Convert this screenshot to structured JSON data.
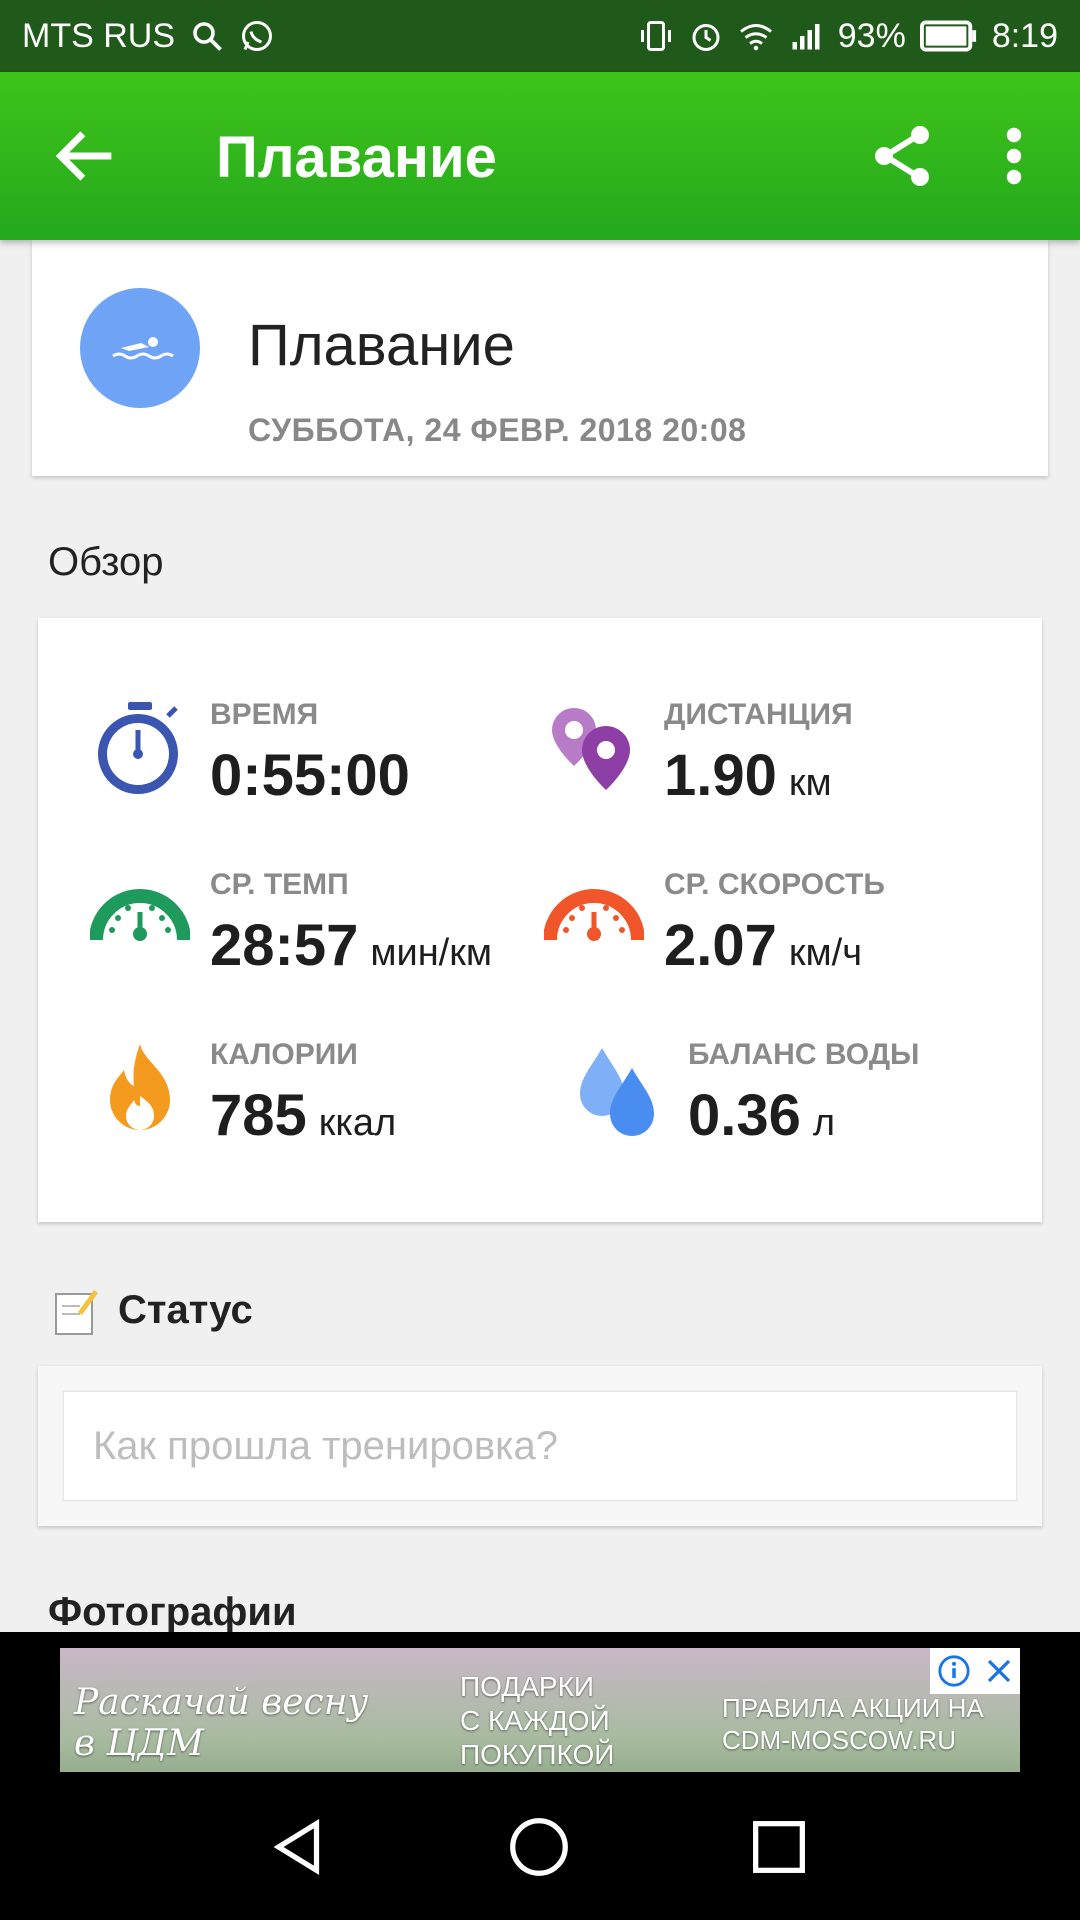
{
  "status_bar": {
    "carrier": "MTS RUS",
    "battery": "93%",
    "time": "8:19"
  },
  "app_bar": {
    "title": "Плавание"
  },
  "activity": {
    "name": "Плавание",
    "datetime": "СУББОТА, 24 ФЕВР. 2018 20:08",
    "avatar_icon": "swimmer-icon",
    "avatar_color": "#6fa3f5"
  },
  "overview": {
    "section_title": "Обзор",
    "metrics": [
      {
        "label": "ВРЕМЯ",
        "value": "0:55:00",
        "unit": "",
        "icon": "stopwatch-icon",
        "color": "#3a56b0"
      },
      {
        "label": "ДИСТАНЦИЯ",
        "value": "1.90",
        "unit": "км",
        "icon": "map-pins-icon",
        "color": "#8e3fa6"
      },
      {
        "label": "СР. ТЕМП",
        "value": "28:57",
        "unit": "мин/км",
        "icon": "gauge-green-icon",
        "color": "#1e9a5c"
      },
      {
        "label": "СР. СКОРОСТЬ",
        "value": "2.07",
        "unit": "км/ч",
        "icon": "gauge-orange-icon",
        "color": "#f0562a"
      },
      {
        "label": "КАЛОРИИ",
        "value": "785",
        "unit": "ккал",
        "icon": "flame-icon",
        "color": "#f49a1f"
      },
      {
        "label": "БАЛАНС ВОДЫ",
        "value": "0.36",
        "unit": "л",
        "icon": "water-drops-icon",
        "color": "#4a8df0"
      }
    ]
  },
  "status": {
    "section_title": "Статус",
    "placeholder": "Как прошла тренировка?"
  },
  "photos": {
    "section_title": "Фотографии"
  },
  "ad": {
    "line1": "Раскачай весну в ЦДМ",
    "line2": "ПОДАРКИ С КАЖДОЙ ПОКУПКОЙ",
    "line3": "ПРАВИЛА АКЦИИ НА CDM-MOSCOW.RU"
  }
}
